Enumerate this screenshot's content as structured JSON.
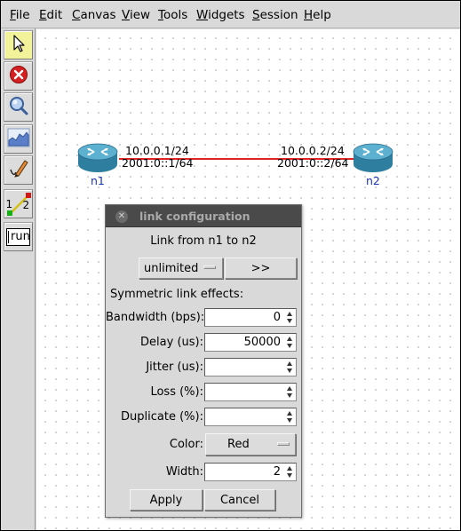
{
  "menubar": {
    "items": [
      {
        "label": "File",
        "underline": "F",
        "rest": "ile"
      },
      {
        "label": "Edit",
        "underline": "E",
        "rest": "dit"
      },
      {
        "label": "Canvas",
        "underline": "C",
        "rest": "anvas"
      },
      {
        "label": "View",
        "underline": "V",
        "rest": "iew"
      },
      {
        "label": "Tools",
        "underline": "T",
        "rest": "ools"
      },
      {
        "label": "Widgets",
        "underline": "W",
        "rest": "idgets"
      },
      {
        "label": "Session",
        "underline": "S",
        "rest": "ession"
      },
      {
        "label": "Help",
        "underline": "H",
        "rest": "elp"
      }
    ]
  },
  "toolbar": {
    "tools": [
      {
        "icon": "select-arrow-icon"
      },
      {
        "icon": "stop-icon"
      },
      {
        "icon": "zoom-icon"
      },
      {
        "icon": "plot-icon"
      },
      {
        "icon": "draw-pencil-icon"
      },
      {
        "icon": "link-tool-icon",
        "left": "1",
        "right": "2"
      },
      {
        "icon": "run-icon",
        "label": "run"
      }
    ]
  },
  "canvas": {
    "nodes": [
      {
        "name": "n1",
        "icon": "router-icon"
      },
      {
        "name": "n2",
        "icon": "router-icon"
      }
    ],
    "link": {
      "color": "#e02424",
      "n1_ipv4": "10.0.0.1/24",
      "n1_ipv6": "2001:0::1/64",
      "n2_ipv4": "10.0.0.2/24",
      "n2_ipv6": "2001:0::2/64"
    }
  },
  "dialog": {
    "title": "link configuration",
    "heading": "Link from n1 to n2",
    "bandwidth_preset": "unlimited",
    "expand_button": ">>",
    "section_label": "Symmetric link effects:",
    "fields": [
      {
        "label": "Bandwidth (bps):",
        "value": "0"
      },
      {
        "label": "Delay (us):",
        "value": "50000"
      },
      {
        "label": "Jitter (us):",
        "value": ""
      },
      {
        "label": "Loss (%):",
        "value": ""
      },
      {
        "label": "Duplicate (%):",
        "value": ""
      }
    ],
    "color_label": "Color:",
    "color_value": "Red",
    "width_label": "Width:",
    "width_value": "2",
    "apply_label": "Apply",
    "cancel_label": "Cancel"
  }
}
